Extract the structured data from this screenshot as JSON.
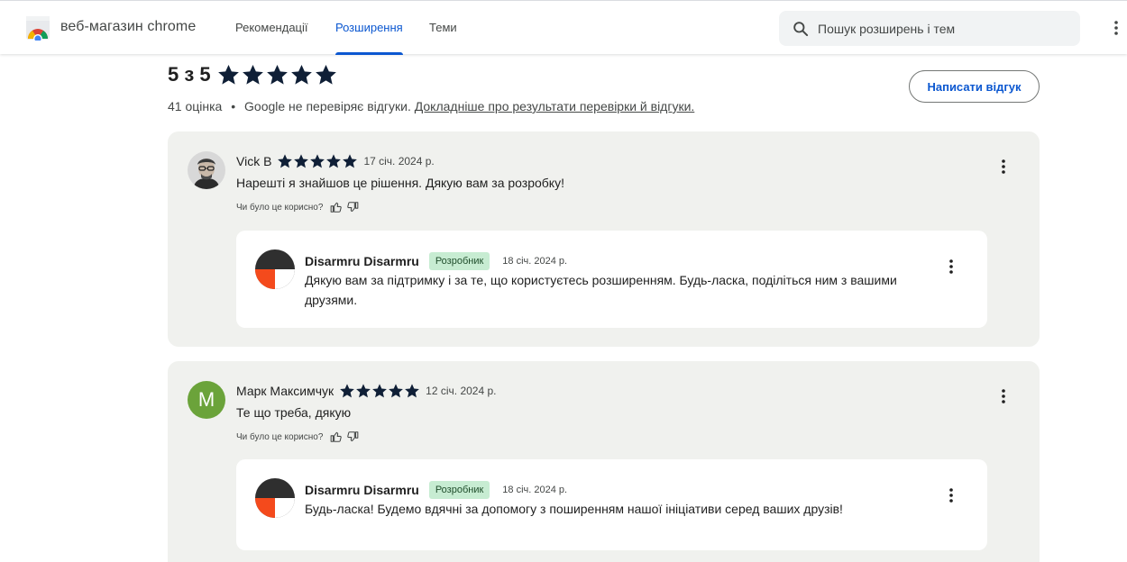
{
  "header": {
    "brand": "веб-магазин chrome",
    "nav": [
      "Рекомендації",
      "Розширення",
      "Теми"
    ],
    "active_nav": "Розширення",
    "search_placeholder": "Пошук розширень і тем"
  },
  "summary": {
    "rating_text": "5 з 5",
    "rating_value": 5,
    "rating_max": 5,
    "count": "41 оцінка",
    "separator": "•",
    "disclaimer": "Google не перевіряє відгуки.",
    "learn_more": "Докладніше про результати перевірки й відгуки.",
    "write_review": "Написати відгук"
  },
  "reviews": [
    {
      "name": "Vick B",
      "stars": 5,
      "date": "17 січ. 2024 р.",
      "text": "Нарешті я знайшов це рішення. Дякую вам за розробку!",
      "helpful_label": "Чи було це корисно?",
      "reply": {
        "name": "Disarmru Disarmru",
        "badge": "Розробник",
        "date": "18 січ. 2024 р.",
        "text": "Дякую вам за підтримку і за те, що користуєтесь розширенням. Будь-ласка, поділіться ним з вашими друзями."
      }
    },
    {
      "name": "Марк Максимчук",
      "avatar_letter": "M",
      "stars": 5,
      "date": "12 січ. 2024 р.",
      "text": "Те що треба, дякую",
      "helpful_label": "Чи було це корисно?",
      "reply": {
        "name": "Disarmru Disarmru",
        "badge": "Розробник",
        "date": "18 січ. 2024 р.",
        "text": "Будь-ласка! Будемо вдячні за допомогу з поширенням нашої ініціативи серед ваших друзів!"
      }
    }
  ],
  "colors": {
    "accent": "#0b57d0",
    "star": "#0f1f36",
    "card_bg": "#f0f1ee",
    "badge_bg": "#c7ecd2",
    "avatar_green": "#6ba33a"
  },
  "icons": [
    "chrome-web-store-logo",
    "search-icon",
    "more-vert-icon",
    "star-icon",
    "thumb-up-icon",
    "thumb-down-icon"
  ]
}
